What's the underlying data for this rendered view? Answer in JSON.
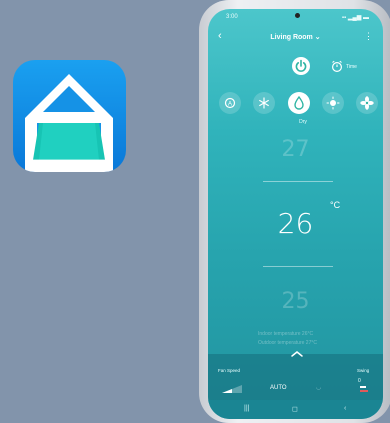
{
  "status": {
    "time": "3:00",
    "icons": "▪▪ ▂▄▆ ▬"
  },
  "header": {
    "back_icon": "‹",
    "title": "Living Room ⌄",
    "more_icon": "⋮"
  },
  "controls": {
    "timer_label": "Time"
  },
  "mode": {
    "selected_label": "Dry"
  },
  "temperature": {
    "previous": "27",
    "current": "26",
    "next": "25",
    "unit": "°C"
  },
  "info": {
    "line1": "Indoor temperature 26°C",
    "line2": "Outdoor temperature 27°C"
  },
  "bottom_panel": {
    "fan_speed_label": "Fan Speed",
    "fan_value": "AUTO",
    "swing_label": "Swing",
    "swing_value": "0"
  },
  "nav": {
    "recents": "|||",
    "home": "◻",
    "back": "‹"
  },
  "colors": {
    "app_icon": "#0a78d8",
    "screen": "#30b3bb",
    "background": "#8294ab"
  }
}
